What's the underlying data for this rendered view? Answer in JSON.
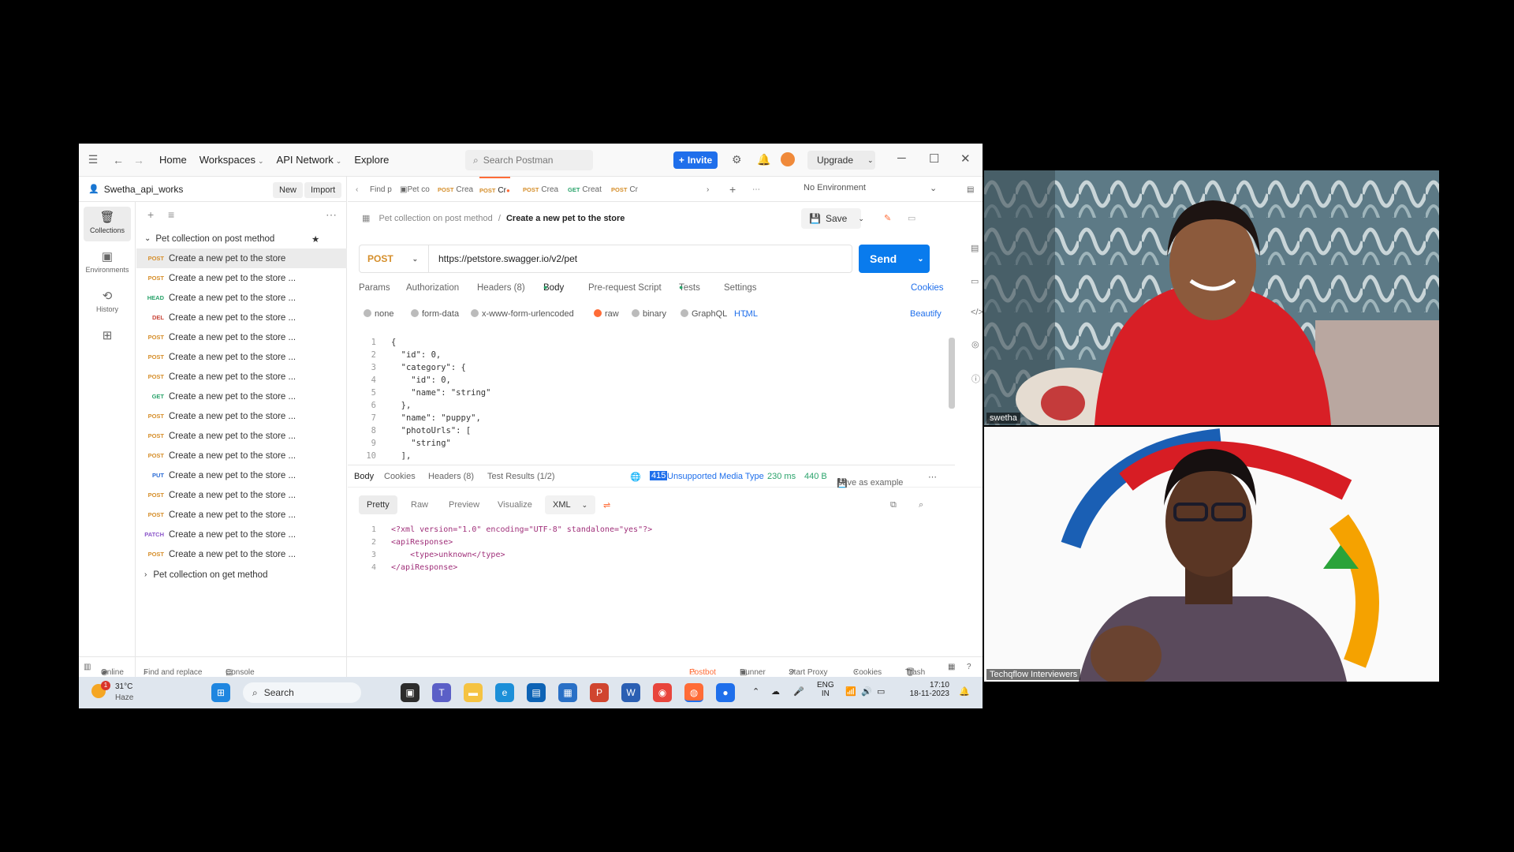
{
  "postman": {
    "nav": {
      "home": "Home",
      "workspaces": "Workspaces",
      "api_network": "API Network",
      "explore": "Explore"
    },
    "search_placeholder": "Search Postman",
    "invite_label": "Invite",
    "upgrade_label": "Upgrade",
    "workspace": {
      "name": "Swetha_api_works",
      "new_label": "New",
      "import_label": "Import"
    },
    "rail": [
      {
        "label": "Collections",
        "icon": "collections-icon"
      },
      {
        "label": "Environments",
        "icon": "environments-icon"
      },
      {
        "label": "History",
        "icon": "history-icon"
      },
      {
        "label": "",
        "icon": "apps-icon"
      }
    ],
    "collection_name": "Pet collection on post method",
    "collection_items": [
      {
        "method": "POST",
        "name": "Create a new pet to the store"
      },
      {
        "method": "POST",
        "name": "Create a new pet to the store ..."
      },
      {
        "method": "HEAD",
        "name": "Create a new pet to the store ..."
      },
      {
        "method": "DEL",
        "name": "Create a new pet to the store ..."
      },
      {
        "method": "POST",
        "name": "Create a new pet to the store ..."
      },
      {
        "method": "POST",
        "name": "Create a new pet to the store ..."
      },
      {
        "method": "POST",
        "name": "Create a new pet to the store ..."
      },
      {
        "method": "GET",
        "name": "Create a new pet to the store ..."
      },
      {
        "method": "POST",
        "name": "Create a new pet to the store ..."
      },
      {
        "method": "POST",
        "name": "Create a new pet to the store ..."
      },
      {
        "method": "POST",
        "name": "Create a new pet to the store ..."
      },
      {
        "method": "PUT",
        "name": "Create a new pet to the store ..."
      },
      {
        "method": "POST",
        "name": "Create a new pet to the store ..."
      },
      {
        "method": "POST",
        "name": "Create a new pet to the store ..."
      },
      {
        "method": "PATCH",
        "name": "Create a new pet to the store ..."
      },
      {
        "method": "POST",
        "name": "Create a new pet to the store ..."
      }
    ],
    "collection2_name": "Pet collection on get method",
    "tabs": [
      {
        "method": "",
        "label": "Find p"
      },
      {
        "method": "",
        "label": "Pet co"
      },
      {
        "method": "POST",
        "label": "Crea"
      },
      {
        "method": "POST",
        "label": "Cr"
      },
      {
        "method": "POST",
        "label": "Crea"
      },
      {
        "method": "GET",
        "label": "Creat"
      },
      {
        "method": "POST",
        "label": "Cr"
      }
    ],
    "environment": "No Environment",
    "breadcrumb": {
      "parent": "Pet collection on post method",
      "sep": "/",
      "current": "Create a new pet to the store"
    },
    "save_label": "Save",
    "request": {
      "method": "POST",
      "url": "https://petstore.swagger.io/v2/pet",
      "send_label": "Send"
    },
    "req_tabs": {
      "params": "Params",
      "auth": "Authorization",
      "headers": "Headers (8)",
      "body": "Body",
      "prerequest": "Pre-request Script",
      "tests": "Tests",
      "settings": "Settings",
      "cookies": "Cookies"
    },
    "body_types": {
      "none": "none",
      "form_data": "form-data",
      "urlencoded": "x-www-form-urlencoded",
      "raw": "raw",
      "binary": "binary",
      "graphql": "GraphQL",
      "format": "HTML",
      "beautify": "Beautify"
    },
    "body_lines": [
      {
        "n": "1",
        "code": "{"
      },
      {
        "n": "2",
        "code": "  \"id\": 0,"
      },
      {
        "n": "3",
        "code": "  \"category\": {"
      },
      {
        "n": "4",
        "code": "    \"id\": 0,"
      },
      {
        "n": "5",
        "code": "    \"name\": \"string\""
      },
      {
        "n": "6",
        "code": "  },"
      },
      {
        "n": "7",
        "code": "  \"name\": \"puppy\","
      },
      {
        "n": "8",
        "code": "  \"photoUrls\": ["
      },
      {
        "n": "9",
        "code": "    \"string\""
      },
      {
        "n": "10",
        "code": "  ],"
      }
    ],
    "response": {
      "tabs": {
        "body": "Body",
        "cookies": "Cookies",
        "headers": "Headers (8)",
        "tests": "Test Results (1/2)"
      },
      "status_code": "415",
      "status_text": "Unsupported Media Type",
      "time": "230 ms",
      "size": "440 B",
      "save_example": "Save as example",
      "views": {
        "pretty": "Pretty",
        "raw": "Raw",
        "preview": "Preview",
        "visualize": "Visualize",
        "format": "XML"
      },
      "lines": [
        {
          "n": "1",
          "code": "<?xml version=\"1.0\" encoding=\"UTF-8\" standalone=\"yes\"?>"
        },
        {
          "n": "2",
          "code": "<apiResponse>"
        },
        {
          "n": "3",
          "code": "    <type>unknown</type>"
        },
        {
          "n": "4",
          "code": "</apiResponse>"
        }
      ]
    },
    "status_bar": {
      "online": "Online",
      "find_replace": "Find and replace",
      "console": "Console",
      "postbot": "Postbot",
      "runner": "Runner",
      "start_proxy": "Start Proxy",
      "cookies": "Cookies",
      "trash": "Trash"
    }
  },
  "taskbar": {
    "weather_temp": "31°C",
    "weather_desc": "Haze",
    "weather_badge": "1",
    "search_label": "Search",
    "lang1": "ENG",
    "lang2": "IN",
    "time": "17:10",
    "date": "18-11-2023"
  },
  "participants": [
    {
      "name": "swetha"
    },
    {
      "name": "Techqflow Interviewers"
    }
  ],
  "colors": {
    "accent": "#ff6c37",
    "send": "#097bed",
    "invite": "#1f6feb",
    "error": "#1f6feb"
  }
}
